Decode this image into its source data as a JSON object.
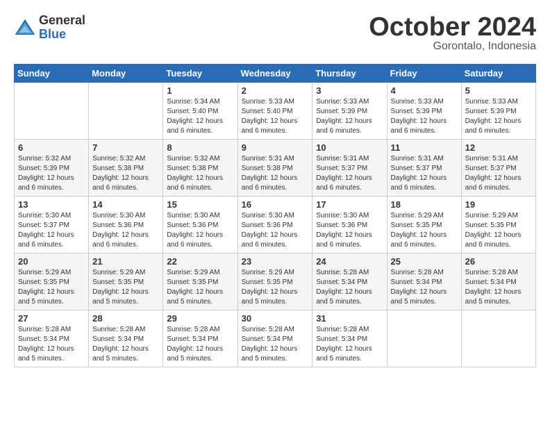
{
  "header": {
    "logo_general": "General",
    "logo_blue": "Blue",
    "month": "October 2024",
    "location": "Gorontalo, Indonesia"
  },
  "days_of_week": [
    "Sunday",
    "Monday",
    "Tuesday",
    "Wednesday",
    "Thursday",
    "Friday",
    "Saturday"
  ],
  "weeks": [
    [
      {
        "day": "",
        "info": ""
      },
      {
        "day": "",
        "info": ""
      },
      {
        "day": "1",
        "info": "Sunrise: 5:34 AM\nSunset: 5:40 PM\nDaylight: 12 hours\nand 6 minutes."
      },
      {
        "day": "2",
        "info": "Sunrise: 5:33 AM\nSunset: 5:40 PM\nDaylight: 12 hours\nand 6 minutes."
      },
      {
        "day": "3",
        "info": "Sunrise: 5:33 AM\nSunset: 5:39 PM\nDaylight: 12 hours\nand 6 minutes."
      },
      {
        "day": "4",
        "info": "Sunrise: 5:33 AM\nSunset: 5:39 PM\nDaylight: 12 hours\nand 6 minutes."
      },
      {
        "day": "5",
        "info": "Sunrise: 5:33 AM\nSunset: 5:39 PM\nDaylight: 12 hours\nand 6 minutes."
      }
    ],
    [
      {
        "day": "6",
        "info": "Sunrise: 5:32 AM\nSunset: 5:39 PM\nDaylight: 12 hours\nand 6 minutes."
      },
      {
        "day": "7",
        "info": "Sunrise: 5:32 AM\nSunset: 5:38 PM\nDaylight: 12 hours\nand 6 minutes."
      },
      {
        "day": "8",
        "info": "Sunrise: 5:32 AM\nSunset: 5:38 PM\nDaylight: 12 hours\nand 6 minutes."
      },
      {
        "day": "9",
        "info": "Sunrise: 5:31 AM\nSunset: 5:38 PM\nDaylight: 12 hours\nand 6 minutes."
      },
      {
        "day": "10",
        "info": "Sunrise: 5:31 AM\nSunset: 5:37 PM\nDaylight: 12 hours\nand 6 minutes."
      },
      {
        "day": "11",
        "info": "Sunrise: 5:31 AM\nSunset: 5:37 PM\nDaylight: 12 hours\nand 6 minutes."
      },
      {
        "day": "12",
        "info": "Sunrise: 5:31 AM\nSunset: 5:37 PM\nDaylight: 12 hours\nand 6 minutes."
      }
    ],
    [
      {
        "day": "13",
        "info": "Sunrise: 5:30 AM\nSunset: 5:37 PM\nDaylight: 12 hours\nand 6 minutes."
      },
      {
        "day": "14",
        "info": "Sunrise: 5:30 AM\nSunset: 5:36 PM\nDaylight: 12 hours\nand 6 minutes."
      },
      {
        "day": "15",
        "info": "Sunrise: 5:30 AM\nSunset: 5:36 PM\nDaylight: 12 hours\nand 6 minutes."
      },
      {
        "day": "16",
        "info": "Sunrise: 5:30 AM\nSunset: 5:36 PM\nDaylight: 12 hours\nand 6 minutes."
      },
      {
        "day": "17",
        "info": "Sunrise: 5:30 AM\nSunset: 5:36 PM\nDaylight: 12 hours\nand 6 minutes."
      },
      {
        "day": "18",
        "info": "Sunrise: 5:29 AM\nSunset: 5:35 PM\nDaylight: 12 hours\nand 6 minutes."
      },
      {
        "day": "19",
        "info": "Sunrise: 5:29 AM\nSunset: 5:35 PM\nDaylight: 12 hours\nand 6 minutes."
      }
    ],
    [
      {
        "day": "20",
        "info": "Sunrise: 5:29 AM\nSunset: 5:35 PM\nDaylight: 12 hours\nand 5 minutes."
      },
      {
        "day": "21",
        "info": "Sunrise: 5:29 AM\nSunset: 5:35 PM\nDaylight: 12 hours\nand 5 minutes."
      },
      {
        "day": "22",
        "info": "Sunrise: 5:29 AM\nSunset: 5:35 PM\nDaylight: 12 hours\nand 5 minutes."
      },
      {
        "day": "23",
        "info": "Sunrise: 5:29 AM\nSunset: 5:35 PM\nDaylight: 12 hours\nand 5 minutes."
      },
      {
        "day": "24",
        "info": "Sunrise: 5:28 AM\nSunset: 5:34 PM\nDaylight: 12 hours\nand 5 minutes."
      },
      {
        "day": "25",
        "info": "Sunrise: 5:28 AM\nSunset: 5:34 PM\nDaylight: 12 hours\nand 5 minutes."
      },
      {
        "day": "26",
        "info": "Sunrise: 5:28 AM\nSunset: 5:34 PM\nDaylight: 12 hours\nand 5 minutes."
      }
    ],
    [
      {
        "day": "27",
        "info": "Sunrise: 5:28 AM\nSunset: 5:34 PM\nDaylight: 12 hours\nand 5 minutes."
      },
      {
        "day": "28",
        "info": "Sunrise: 5:28 AM\nSunset: 5:34 PM\nDaylight: 12 hours\nand 5 minutes."
      },
      {
        "day": "29",
        "info": "Sunrise: 5:28 AM\nSunset: 5:34 PM\nDaylight: 12 hours\nand 5 minutes."
      },
      {
        "day": "30",
        "info": "Sunrise: 5:28 AM\nSunset: 5:34 PM\nDaylight: 12 hours\nand 5 minutes."
      },
      {
        "day": "31",
        "info": "Sunrise: 5:28 AM\nSunset: 5:34 PM\nDaylight: 12 hours\nand 5 minutes."
      },
      {
        "day": "",
        "info": ""
      },
      {
        "day": "",
        "info": ""
      }
    ]
  ]
}
